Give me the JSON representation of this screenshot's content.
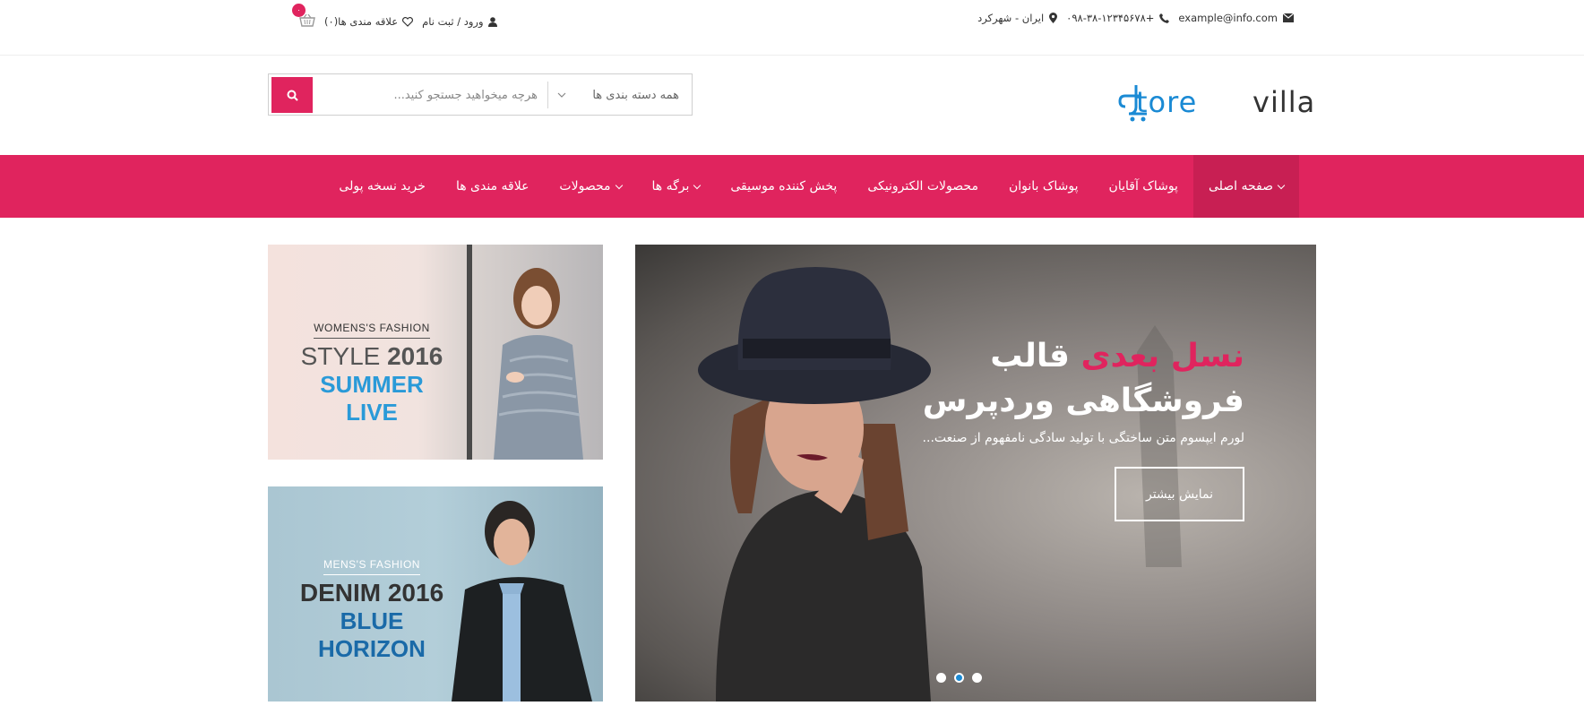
{
  "topbar": {
    "email": "example@info.com",
    "phone": "۰۹۸-۳۸-۱۲۳۴۵۶۷۸+",
    "location": "ایران - شهرکرد",
    "login": "ورود / ثبت نام",
    "wishlist": "علاقه مندی ها(۰)",
    "cart_count": "۰"
  },
  "header": {
    "logo_store": "tore",
    "logo_villa": "villa",
    "search_placeholder": "هرچه میخواهید جستجو کنید...",
    "category_label": "همه دسته بندی ها"
  },
  "nav": {
    "items": [
      {
        "label": "صفحه اصلی",
        "dropdown": true,
        "active": true
      },
      {
        "label": "پوشاک آقایان",
        "dropdown": false,
        "active": false
      },
      {
        "label": "پوشاک بانوان",
        "dropdown": false,
        "active": false
      },
      {
        "label": "محصولات الکترونیکی",
        "dropdown": false,
        "active": false
      },
      {
        "label": "پخش کننده موسیقی",
        "dropdown": false,
        "active": false
      },
      {
        "label": "برگه ها",
        "dropdown": true,
        "active": false
      },
      {
        "label": "محصولات",
        "dropdown": true,
        "active": false
      },
      {
        "label": "علاقه مندی ها",
        "dropdown": false,
        "active": false
      },
      {
        "label": "خرید نسخه پولی",
        "dropdown": false,
        "active": false
      }
    ]
  },
  "banners": {
    "women": {
      "small": "WOMENS'S FASHION",
      "mid_light": "STYLE",
      "mid_bold": "2016",
      "big": "SUMMER LIVE"
    },
    "men": {
      "small": "MENS'S FASHION",
      "mid_light": "DENIM",
      "mid_bold": "2016",
      "big": "BLUE HORIZON"
    }
  },
  "slider": {
    "title_accent": "نسل بعدی",
    "title_rest": "قالب",
    "title_line2": "فروشگاهی وردپرس",
    "description": "لورم ایپسوم متن ساختگی با تولید سادگی نامفهوم از صنعت...",
    "button_label": "نمایش بیشتر",
    "dots": 3,
    "active_dot": 2
  },
  "colors": {
    "accent": "#e0245e",
    "brand_blue": "#1a8ad4",
    "nav_active": "#c81f53"
  }
}
